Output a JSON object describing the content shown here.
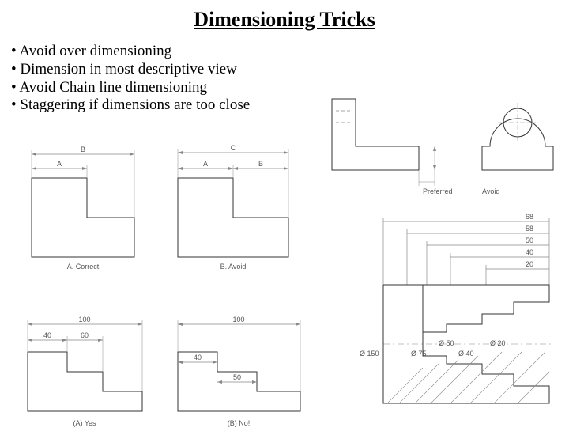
{
  "title": "Dimensioning Tricks",
  "bullets": [
    "Avoid over dimensioning",
    "Dimension in most descriptive view",
    "Avoid Chain line dimensioning",
    "Staggering if dimensions are too close"
  ],
  "figA": {
    "labels": {
      "a": "A",
      "b": "B"
    },
    "caption": "A. Correct"
  },
  "figB": {
    "labels": {
      "a": "A",
      "b": "B",
      "c": "C"
    },
    "caption": "B. Avoid"
  },
  "figPreferredAvoid": {
    "preferred": "Preferred",
    "avoid": "Avoid"
  },
  "figChainA": {
    "overall": "100",
    "d1": "40",
    "d2": "60",
    "caption": "(A) Yes"
  },
  "figChainB": {
    "overall": "100",
    "d1": "40",
    "d2": "50",
    "caption": "(B) No!"
  },
  "figStagger": {
    "dims": [
      "68",
      "58",
      "50",
      "40",
      "20"
    ],
    "diams": [
      "Ø 150",
      "Ø 75",
      "Ø 40",
      "Ø 50",
      "Ø 20"
    ]
  }
}
